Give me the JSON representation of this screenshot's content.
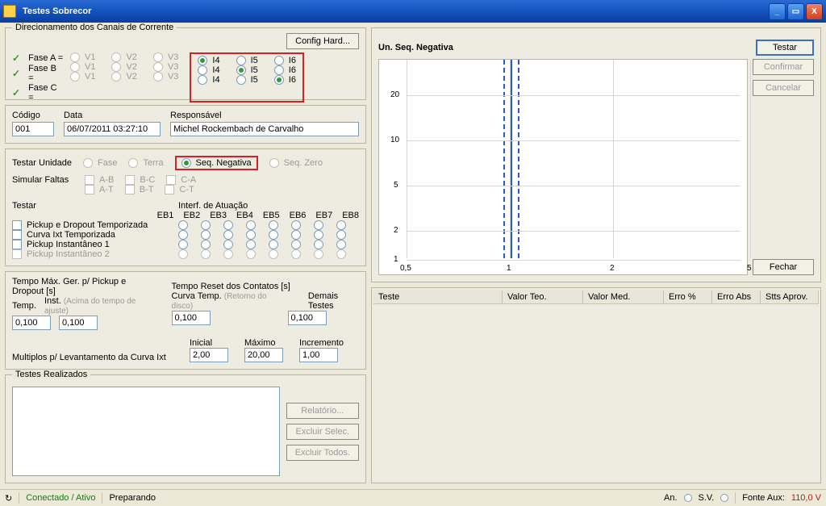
{
  "titlebar": {
    "title": "Testes Sobrecor"
  },
  "direc": {
    "legend": "Direcionamento dos Canais de Corrente",
    "config_btn": "Config Hard...",
    "phases": [
      "Fase A =",
      "Fase B =",
      "Fase C ="
    ],
    "vcols": [
      "V1",
      "V2",
      "V3"
    ],
    "icols": [
      "I4",
      "I5",
      "I6"
    ],
    "selected": [
      0,
      1,
      2
    ]
  },
  "ident": {
    "codigo_lbl": "Código",
    "codigo": "001",
    "data_lbl": "Data",
    "data": "06/07/2011 03:27:10",
    "resp_lbl": "Responsável",
    "resp": "Michel Rockembach de Carvalho"
  },
  "testconf": {
    "testar_unidade": "Testar Unidade",
    "fase": "Fase",
    "terra": "Terra",
    "seqneg": "Seq. Negativa",
    "seqzero": "Seq. Zero",
    "simular": "Simular Faltas",
    "ab": "A-B",
    "bc": "B-C",
    "ca": "C-A",
    "at": "A-T",
    "bt": "B-T",
    "ct": "C-T",
    "testar": "Testar",
    "interf": "Interf. de Atuação",
    "ebs": [
      "EB1",
      "EB2",
      "EB3",
      "EB4",
      "EB5",
      "EB6",
      "EB7",
      "EB8"
    ],
    "t1": "Pickup e Dropout Temporizada",
    "t2": "Curva Ixt Temporizada",
    "t3": "Pickup Instantâneo 1",
    "t4": "Pickup Instantâneo 2"
  },
  "timing": {
    "tempomax": "Tempo Máx. Ger. p/ Pickup e Dropout [s]",
    "temp_lbl": "Temp.",
    "inst_lbl": "Inst.",
    "inst_note": "(Acima do tempo de ajuste)",
    "temp": "0,100",
    "inst": "0,100",
    "reset_lbl": "Tempo Reset dos Contatos [s]",
    "curva_lbl": "Curva Temp.",
    "curva_note": "(Retorno do disco)",
    "demais_lbl": "Demais Testes",
    "curva": "0,100",
    "demais": "0,100",
    "mult_lbl": "Multiplos p/ Levantamento da Curva Ixt",
    "ini_lbl": "Inicial",
    "max_lbl": "Máximo",
    "inc_lbl": "Incremento",
    "ini": "2,00",
    "max": "20,00",
    "inc": "1,00"
  },
  "realizados": {
    "legend": "Testes Realizados",
    "relatorio": "Relatório...",
    "excluir_sel": "Excluir Selec.",
    "excluir_todos": "Excluir Todos."
  },
  "plot": {
    "title": "Un. Seq. Negativa",
    "yticks": [
      "20",
      "10",
      "5",
      "2",
      "1"
    ],
    "xticks": [
      "0,5",
      "1",
      "2",
      "5"
    ]
  },
  "sidebtn": {
    "testar": "Testar",
    "confirmar": "Confirmar",
    "cancelar": "Cancelar",
    "fechar": "Fechar"
  },
  "results": {
    "cols": [
      "Teste",
      "Valor Teo.",
      "Valor Med.",
      "Erro %",
      "Erro Abs",
      "Stts Aprov."
    ]
  },
  "status": {
    "conn": "Conectado / Ativo",
    "prep": "Preparando",
    "an": "An.",
    "sv": "S.V.",
    "fonte": "Fonte Aux:",
    "fonte_val": "110,0 V"
  },
  "chart_data": {
    "type": "line",
    "title": "Un. Seq. Negativa",
    "xscale": "log",
    "yscale": "log",
    "xlim": [
      0.5,
      5
    ],
    "ylim": [
      1,
      20
    ],
    "xticks": [
      0.5,
      1,
      2,
      5
    ],
    "yticks": [
      1,
      2,
      5,
      10,
      20
    ],
    "series": [
      {
        "name": "marker",
        "x": [
          1
        ],
        "type": "vline"
      }
    ]
  }
}
